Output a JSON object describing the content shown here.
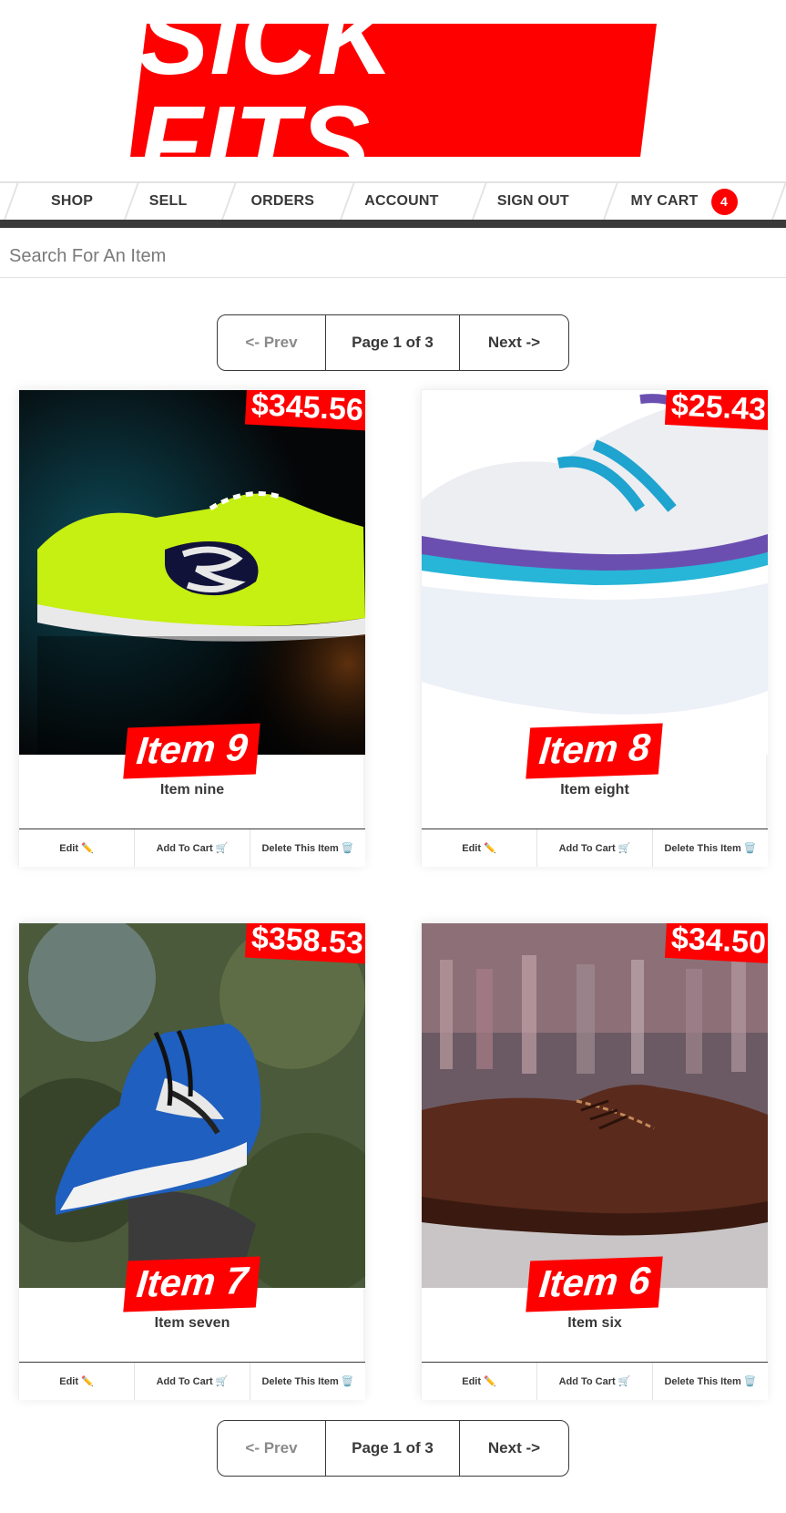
{
  "brand": {
    "logo_text": "SICK FITS"
  },
  "nav": {
    "items": [
      "SHOP",
      "SELL",
      "ORDERS",
      "ACCOUNT",
      "SIGN OUT"
    ],
    "cart_label": "MY CART",
    "cart_count": "4"
  },
  "search": {
    "placeholder": "Search For An Item",
    "value": ""
  },
  "pagination": {
    "prev": "<- Prev",
    "page": "Page 1 of 3",
    "next": "Next ->"
  },
  "items": [
    {
      "title": "Item 9",
      "price": "$345.56",
      "description": "Item nine",
      "image": "green-running-shoe"
    },
    {
      "title": "Item 8",
      "price": "$25.43",
      "description": "Item eight",
      "image": "white-blue-running-shoe"
    },
    {
      "title": "Item 7",
      "price": "$358.53",
      "description": "Item seven",
      "image": "blue-high-top-sneaker"
    },
    {
      "title": "Item 6",
      "price": "$34.50",
      "description": "Item six",
      "image": "brown-leather-shoe"
    }
  ],
  "item_actions": {
    "edit": "Edit ✏️",
    "add_to_cart": "Add To Cart 🛒",
    "delete": "Delete This Item 🗑️"
  },
  "colors": {
    "brand_red": "#ff0000",
    "text": "#393939",
    "nav_bar": "#3a3a3a"
  }
}
